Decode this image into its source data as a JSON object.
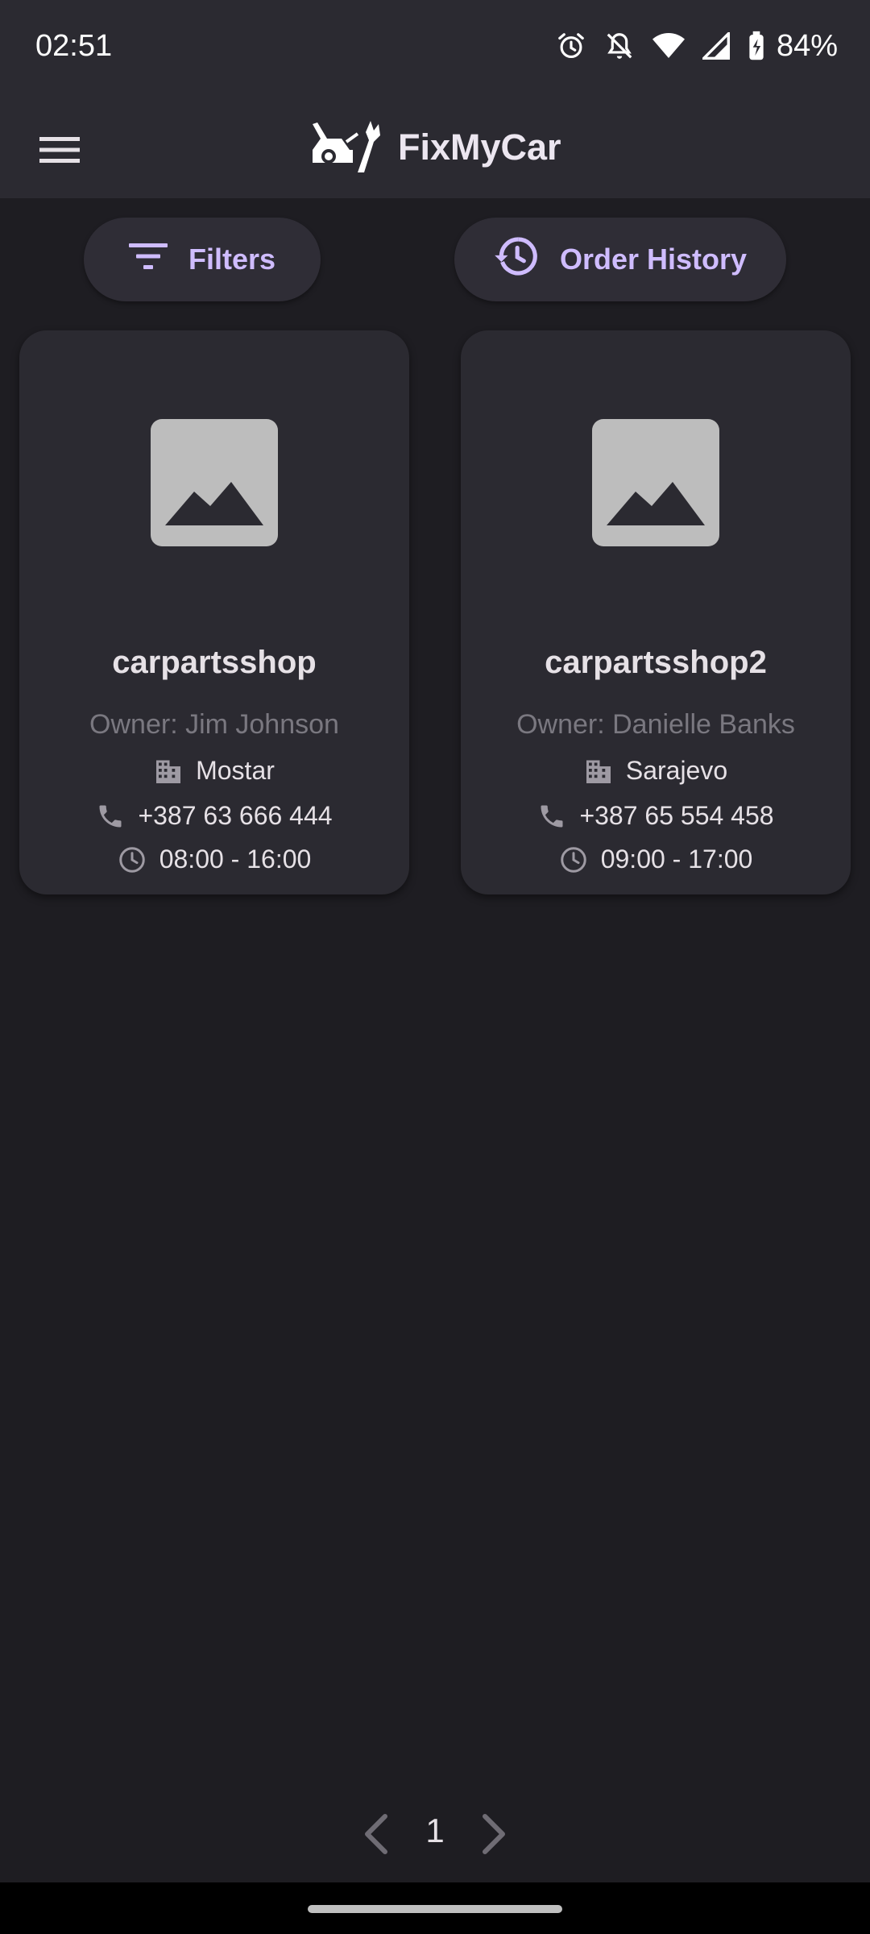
{
  "status_bar": {
    "time": "02:51",
    "battery": "84%",
    "icons": [
      "alarm-icon",
      "notifications-off-icon",
      "wifi-icon",
      "signal-icon",
      "battery-charging-icon"
    ]
  },
  "app_bar": {
    "title": "FixMyCar",
    "menu_icon": "menu-icon",
    "logo_icon": "car-wrench-logo"
  },
  "actions": {
    "filters_label": "Filters",
    "history_label": "Order History"
  },
  "shops": [
    {
      "name": "carpartsshop",
      "owner": "Owner: Jim Johnson",
      "city": "Mostar",
      "phone": "+387 63 666 444",
      "hours": "08:00 - 16:00"
    },
    {
      "name": "carpartsshop2",
      "owner": "Owner: Danielle Banks",
      "city": "Sarajevo",
      "phone": "+387 65 554 458",
      "hours": "09:00 - 17:00"
    }
  ],
  "pagination": {
    "current_page": "1"
  },
  "colors": {
    "background": "#1e1d22",
    "surface": "#2b2a31",
    "accent": "#cfbcff",
    "muted_text": "#7a7880"
  }
}
